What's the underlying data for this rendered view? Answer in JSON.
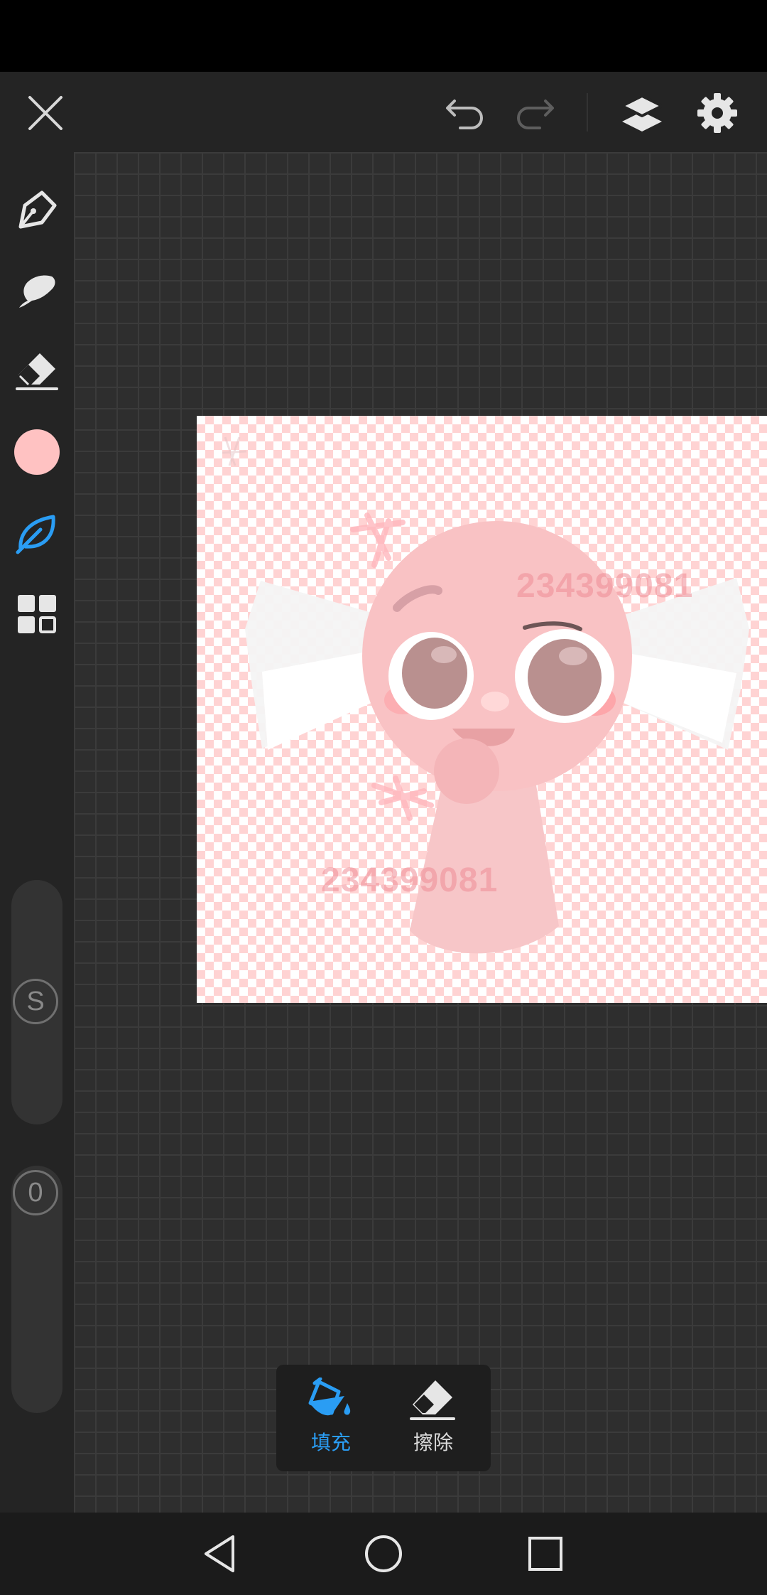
{
  "toolbar": {
    "close_icon": "close-icon",
    "undo_icon": "undo-icon",
    "redo_icon": "redo-icon",
    "layers_icon": "layers-icon",
    "settings_icon": "settings-icon"
  },
  "tools": [
    {
      "name": "pen",
      "icon": "pen-icon"
    },
    {
      "name": "smudge",
      "icon": "smudge-icon"
    },
    {
      "name": "eraser",
      "icon": "eraser-icon"
    },
    {
      "name": "color",
      "icon": "color-swatch",
      "color": "#ffc2c2"
    },
    {
      "name": "brush-library",
      "icon": "leaf-icon",
      "active": true
    },
    {
      "name": "more-tools",
      "icon": "grid-icon"
    }
  ],
  "sliders": {
    "size_label": "S",
    "opacity_label": "0"
  },
  "canvas": {
    "watermark_1": "234399081",
    "watermark_2": "234399081"
  },
  "fill_popup": {
    "fill_label": "填充",
    "erase_label": "擦除",
    "accent_color": "#2a9df4"
  },
  "nav": {
    "back_icon": "back-icon",
    "home_icon": "home-icon",
    "recents_icon": "recents-icon"
  }
}
